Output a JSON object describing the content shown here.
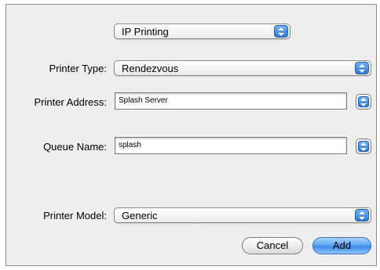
{
  "connection_popup": {
    "value": "IP Printing"
  },
  "printer_type": {
    "label": "Printer Type:",
    "value": "Rendezvous"
  },
  "printer_address": {
    "label": "Printer Address:",
    "value": "Splash Server"
  },
  "queue_name": {
    "label": "Queue Name:",
    "value": "splash"
  },
  "printer_model": {
    "label": "Printer Model:",
    "value": "Generic"
  },
  "buttons": {
    "cancel": "Cancel",
    "add": "Add"
  },
  "colors": {
    "accent": "#3e8ae6",
    "panel_bg": "#eeeeee"
  }
}
